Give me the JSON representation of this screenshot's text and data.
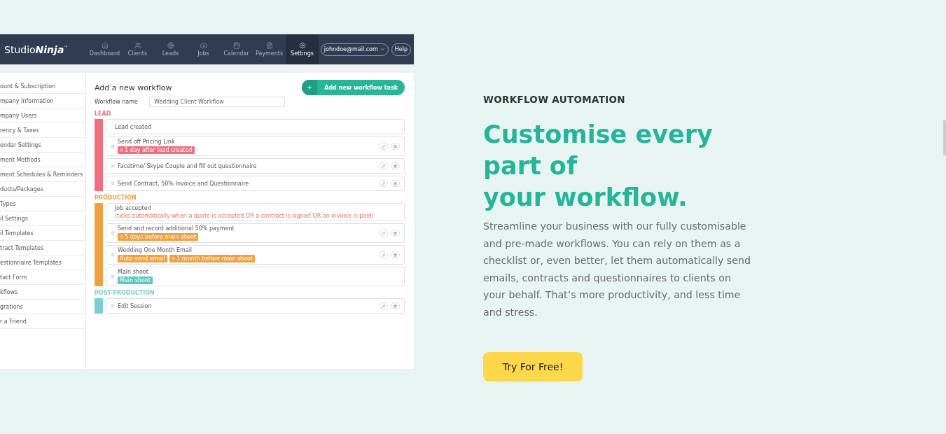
{
  "app": {
    "logo": {
      "plain": "Studio",
      "bold": "Ninja",
      "mark": "™"
    },
    "nav": [
      {
        "label": "Dashboard",
        "selected": false
      },
      {
        "label": "Clients",
        "selected": false
      },
      {
        "label": "Leads",
        "selected": false
      },
      {
        "label": "Jobs",
        "selected": false
      },
      {
        "label": "Calendar",
        "selected": false
      },
      {
        "label": "Payments",
        "selected": false
      },
      {
        "label": "Settings",
        "selected": true
      }
    ],
    "account": "johndoe@mail.com",
    "help": "Help",
    "sidebar": [
      "ount & Subscription",
      "mpany Information",
      "mpany Users",
      "rency & Taxes",
      "endar Settings",
      "ment Methods",
      "ment Schedules & Reminders",
      "ducts/Packages",
      "Types",
      "il Settings",
      "il Templates",
      "tract Templates",
      "estionnaire Templates",
      "tact Form",
      "kflows",
      "grations",
      "r a Friend"
    ],
    "title": "Add a new workflow",
    "add_button": "Add new workflow task",
    "name_label": "Workflow name",
    "name_value": "Wedding Client Workflow",
    "stages": [
      {
        "label": "LEAD",
        "color": "#ee6f7f",
        "tasks": [
          {
            "kind": "start",
            "title": "Lead created"
          },
          {
            "kind": "task",
            "title": "Send off Pricing Link",
            "badges": [
              {
                "kind": "time",
                "text": "1 day after lead created",
                "color": "#ee6f7f"
              }
            ]
          },
          {
            "kind": "task",
            "title": "Facetime/ Skype Couple and fill out questionnaire"
          },
          {
            "kind": "task",
            "title": "Send Contract, 50% Invoice and Questionnaire"
          }
        ]
      },
      {
        "label": "PRODUCTION",
        "color": "#f0a040",
        "tasks": [
          {
            "kind": "start",
            "title": "Job accepted",
            "note": "(ticks automatically when a quote is accepted OR a contract is signed OR an invoice is paid)"
          },
          {
            "kind": "task",
            "title": "Send and record additional 50% payment",
            "badges": [
              {
                "kind": "time",
                "text": "5 days before main shoot",
                "color": "#f0a040"
              }
            ]
          },
          {
            "kind": "task",
            "title": "Wedding One Month Email",
            "badges": [
              {
                "kind": "plain",
                "text": "Auto send email",
                "color": "#f0a040"
              },
              {
                "kind": "time",
                "text": "1 month before main shoot",
                "color": "#f0a040"
              }
            ]
          },
          {
            "kind": "fixed",
            "title": "Main shoot",
            "badges": [
              {
                "kind": "plain",
                "text": "Main shoot",
                "color": "#5cc9bd"
              }
            ]
          }
        ]
      },
      {
        "label": "POST-PRODUCTION",
        "color": "#7fcbd6",
        "tasks": [
          {
            "kind": "task",
            "title": "Edit Session"
          }
        ]
      }
    ]
  },
  "eyebrow": "WORKFLOW AUTOMATION",
  "headline": [
    "Customise every",
    "part of",
    "your workflow."
  ],
  "body": "Streamline your business with our fully customisable and pre-made workflows. You can rely on them as a checklist or, even better, let them automatically send emails, contracts and questionnaires to clients on your behalf. That’s more productivity, and less time and stress.",
  "cta": "Try For Free!"
}
